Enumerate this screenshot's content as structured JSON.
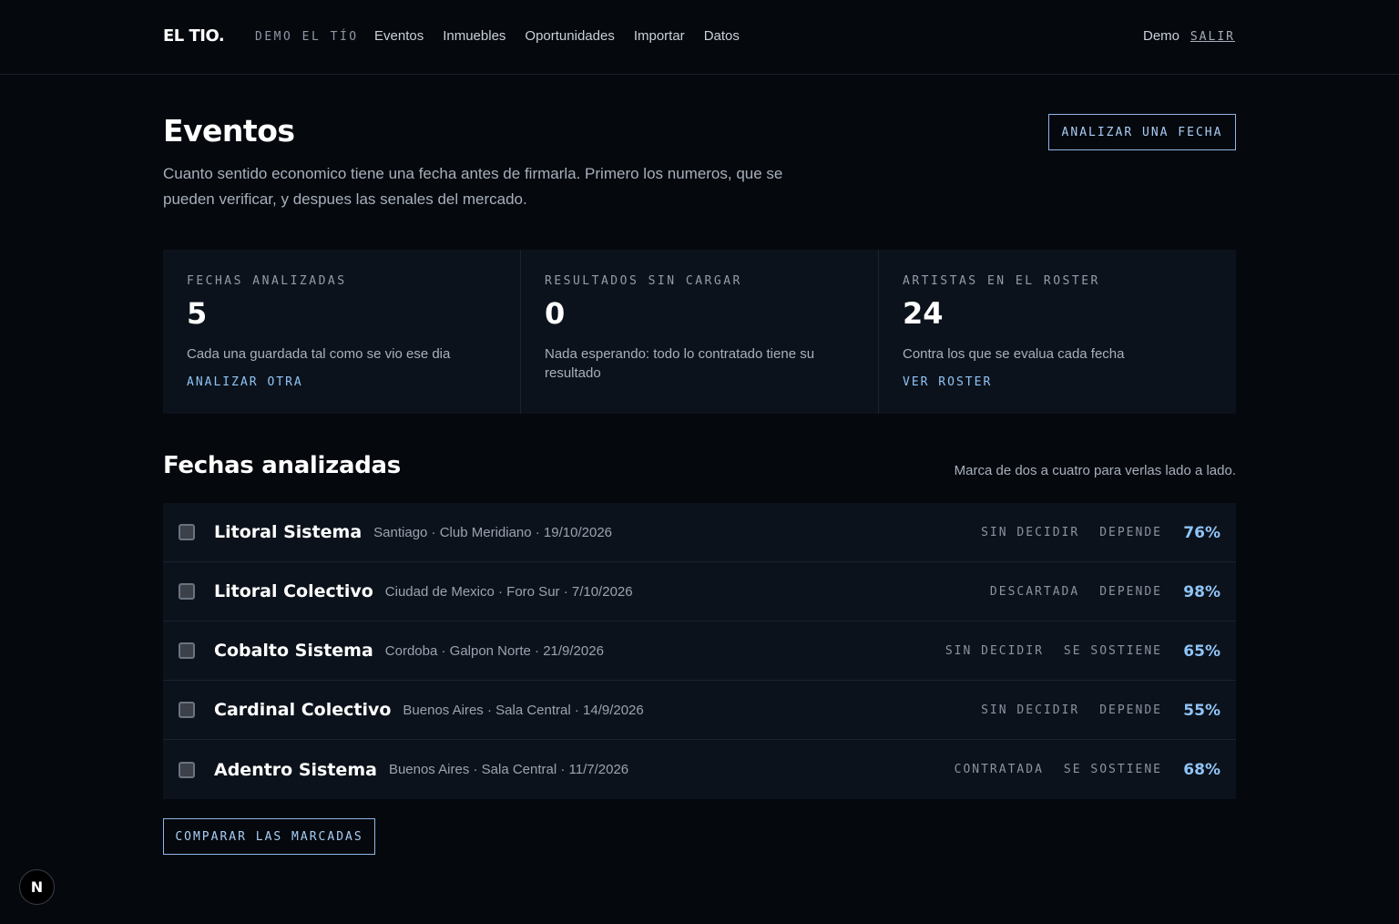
{
  "header": {
    "brand": "EL TIO.",
    "org": "DEMO EL TÍO",
    "nav": [
      "Eventos",
      "Inmuebles",
      "Oportunidades",
      "Importar",
      "Datos"
    ],
    "user": "Demo",
    "logout": "SALIR"
  },
  "hero": {
    "title": "Eventos",
    "description": "Cuanto sentido economico tiene una fecha antes de firmarla. Primero los numeros, que se pueden verificar, y despues las senales del mercado.",
    "primary_button": "ANALIZAR UNA FECHA"
  },
  "stats": [
    {
      "label": "FECHAS ANALIZADAS",
      "value": "5",
      "description": "Cada una guardada tal como se vio ese dia",
      "link": "ANALIZAR OTRA"
    },
    {
      "label": "RESULTADOS SIN CARGAR",
      "value": "0",
      "description": "Nada esperando: todo lo contratado tiene su resultado",
      "link": ""
    },
    {
      "label": "ARTISTAS EN EL ROSTER",
      "value": "24",
      "description": "Contra los que se evalua cada fecha",
      "link": "VER ROSTER"
    }
  ],
  "list": {
    "title": "Fechas analizadas",
    "hint": "Marca de dos a cuatro para verlas lado a lado.",
    "rows": [
      {
        "name": "Litoral Sistema",
        "meta": "Santiago · Club Meridiano · 19/10/2026",
        "decision": "SIN DECIDIR",
        "outlook": "DEPENDE",
        "percent": "76%"
      },
      {
        "name": "Litoral Colectivo",
        "meta": "Ciudad de Mexico · Foro Sur · 7/10/2026",
        "decision": "DESCARTADA",
        "outlook": "DEPENDE",
        "percent": "98%"
      },
      {
        "name": "Cobalto Sistema",
        "meta": "Cordoba · Galpon Norte · 21/9/2026",
        "decision": "SIN DECIDIR",
        "outlook": "SE SOSTIENE",
        "percent": "65%"
      },
      {
        "name": "Cardinal Colectivo",
        "meta": "Buenos Aires · Sala Central · 14/9/2026",
        "decision": "SIN DECIDIR",
        "outlook": "DEPENDE",
        "percent": "55%"
      },
      {
        "name": "Adentro Sistema",
        "meta": "Buenos Aires · Sala Central · 11/7/2026",
        "decision": "CONTRATADA",
        "outlook": "SE SOSTIENE",
        "percent": "68%"
      }
    ],
    "compare_button": "COMPARAR LAS MARCADAS"
  },
  "dev_badge": "N",
  "colors": {
    "background": "#05080d",
    "panel": "#0c121b",
    "accent": "#8fc4f7"
  }
}
